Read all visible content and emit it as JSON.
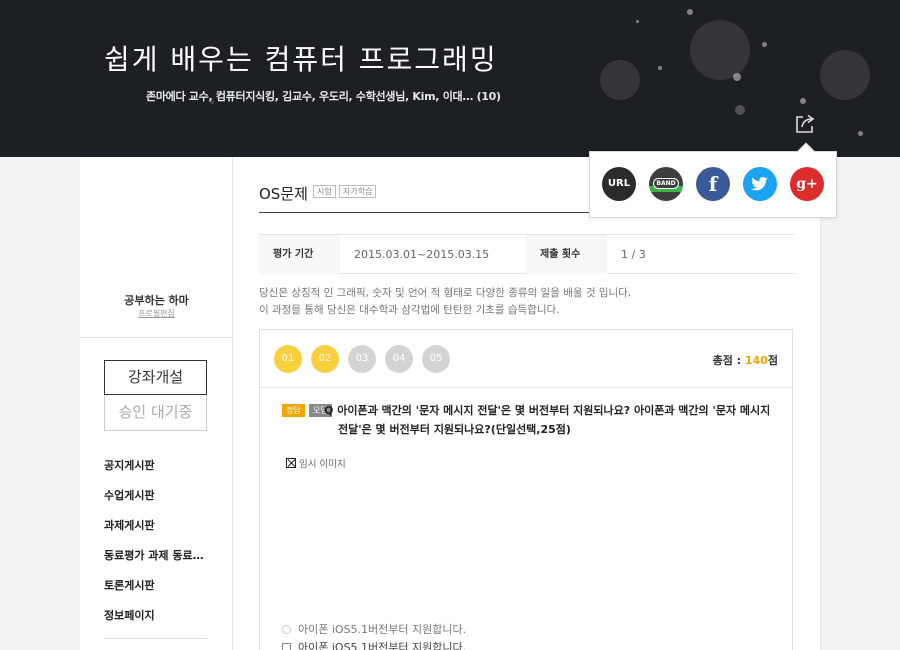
{
  "header": {
    "title": "쉽게 배우는 컴퓨터 프로그래밍",
    "instructors": "존마에다 교수, 컴퓨터지식킹, 김교수, 우도리, 수학선생님, Kim, 이대… (10)",
    "share_icon": "share-icon"
  },
  "share_popup": {
    "items": [
      {
        "label": "URL",
        "icon": "link-icon",
        "color": "#2b2b2b"
      },
      {
        "label": "BAND",
        "icon": "band-icon",
        "color": "#3bb54a"
      },
      {
        "label": "f",
        "icon": "facebook-icon",
        "color": "#3b5998"
      },
      {
        "label": "🐦",
        "icon": "twitter-icon",
        "color": "#1da1f2"
      },
      {
        "label": "g+",
        "icon": "google-plus-icon",
        "color": "#dd2c2c"
      }
    ]
  },
  "sidebar": {
    "profile_name": "공부하는 하마",
    "profile_edit": "프로필편집",
    "open_course": "강좌개설",
    "pending": "승인 대기중",
    "menu": [
      {
        "label": "공지게시판"
      },
      {
        "label": "수업게시판"
      },
      {
        "label": "과제게시판"
      },
      {
        "label": "동료평가 과제 동료…"
      },
      {
        "label": "토론게시판"
      },
      {
        "label": "정보페이지"
      }
    ]
  },
  "quiz": {
    "title": "OS문제",
    "tags": [
      "시험",
      "자가학습"
    ],
    "period_label": "평가 기간",
    "period_value": "2015.03.01~2015.03.15",
    "submit_label": "제출 횟수",
    "submit_value": "1 / 3",
    "description": [
      "당신은 상징적 인 그래픽, 숫자 및 언어 적 형태로 다양한 종류의 일을 배울 것 입니다.",
      "이 과정을 통해 당신은 대수학과 삼각법에 탄탄한 기초를 습득합니다."
    ],
    "steps": [
      "01",
      "02",
      "03",
      "04",
      "05"
    ],
    "steps_done": 2,
    "score_label": "총점 :",
    "score_value": "140",
    "score_unit": "점",
    "badge_correct": "정답",
    "badge_wrong": "오답",
    "question_mark": "Q",
    "question": "아이폰과 맥간의 '문자 메시지 전달'은 몇 버전부터 지원되나요? 아이폰과 맥간의 '문자 메시지 전달'은 몇 버전부터 지원되나요?(단일선택,25점)",
    "image_placeholder": "임시 이미지",
    "options": [
      "아이폰 iOS5.1버전부터 지원합니다.",
      "아이폰 iOS5.1버전부터 지원합니다."
    ]
  },
  "colors": {
    "header_bg": "#1c1f24",
    "accent": "#f8cf3c",
    "score": "#f0a500"
  }
}
